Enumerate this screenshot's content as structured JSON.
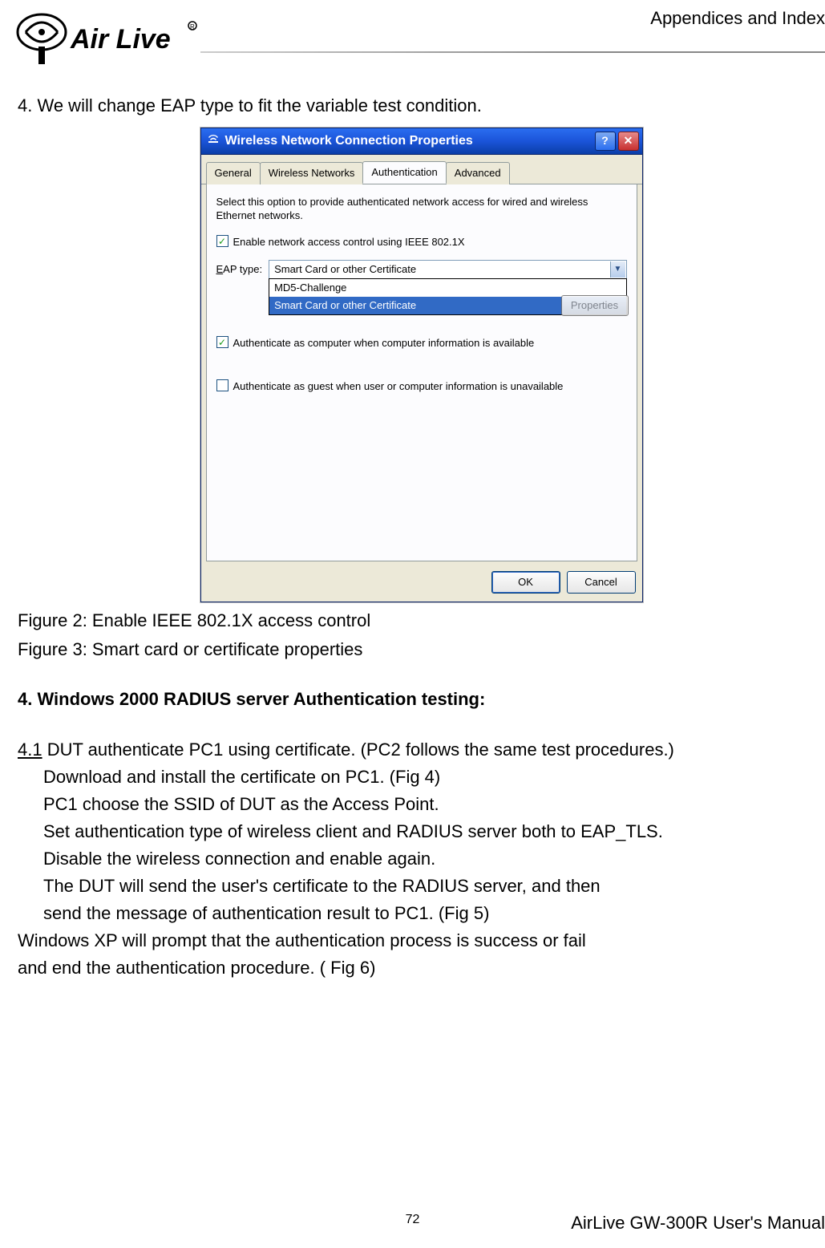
{
  "header": {
    "section": "Appendices and Index"
  },
  "intro": "4. We will change EAP type to fit the variable test condition.",
  "dialog": {
    "title": "Wireless Network Connection Properties",
    "help_glyph": "?",
    "close_glyph": "✕",
    "tabs": [
      "General",
      "Wireless Networks",
      "Authentication",
      "Advanced"
    ],
    "active_tab": 2,
    "desc": "Select this option to provide authenticated network access for wired and wireless Ethernet networks.",
    "check_enable": "Enable network access control using IEEE 802.1X",
    "eap_label_pre": "E",
    "eap_label_text": "EAP type:",
    "combo_selected": "Smart Card or other Certificate",
    "combo_items": [
      "MD5-Challenge",
      "Smart Card or other Certificate"
    ],
    "props_label": "Properties",
    "check_computer": "Authenticate as computer when computer information is available",
    "check_guest": "Authenticate as guest when user or computer information is unavailable",
    "btn_ok": "OK",
    "btn_cancel": "Cancel"
  },
  "captions": {
    "fig2": "Figure 2: Enable IEEE 802.1X access control",
    "fig3": "Figure 3: Smart card or certificate properties"
  },
  "section4_title": "4. Windows 2000 RADIUS server Authentication testing:",
  "section41": {
    "num": "4.1",
    "head_rest": " DUT authenticate PC1 using certificate. (PC2 follows the same test procedures.)",
    "lines": [
      "Download and install the certificate on PC1. (Fig 4)",
      "PC1 choose the SSID of DUT as the Access Point.",
      "Set authentication type of wireless client and RADIUS server both to EAP_TLS.",
      "Disable the wireless connection and enable again.",
      "The DUT will send the user's certificate to the RADIUS server, and then",
      "send the message of authentication result to PC1. (Fig 5)"
    ],
    "tail1": "Windows XP will prompt that the authentication process is success or fail",
    "tail2": "and end the authentication procedure. ( Fig 6)"
  },
  "footer": {
    "page": "72",
    "manual": "AirLive GW-300R User's Manual"
  }
}
